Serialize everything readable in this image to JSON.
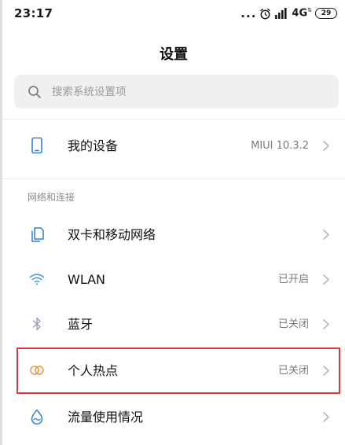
{
  "status_bar": {
    "time": "23:17",
    "dots": "...",
    "network": "4G",
    "network_sup": "⇅",
    "battery": "29",
    "icons": [
      "alarm-icon",
      "signal-icon"
    ]
  },
  "title": "设置",
  "search": {
    "placeholder": "搜索系统设置项"
  },
  "my_device": {
    "label": "我的设备",
    "value": "MIUI 10.3.2",
    "icon": "phone-icon"
  },
  "section_network": {
    "header": "网络和连接",
    "items": [
      {
        "label": "双卡和移动网络",
        "value": "",
        "icon": "sim-card-icon"
      },
      {
        "label": "WLAN",
        "value": "已开启",
        "icon": "wifi-icon"
      },
      {
        "label": "蓝牙",
        "value": "已关闭",
        "icon": "bluetooth-icon"
      },
      {
        "label": "个人热点",
        "value": "已关闭",
        "icon": "hotspot-icon"
      },
      {
        "label": "流量使用情况",
        "value": "",
        "icon": "data-drop-icon"
      }
    ]
  },
  "colors": {
    "icon_blue": "#2f7fd6",
    "bluetooth_icon": "#9a9eb6",
    "hotspot_icon": "#e8974a",
    "highlight": "#d9393f"
  }
}
